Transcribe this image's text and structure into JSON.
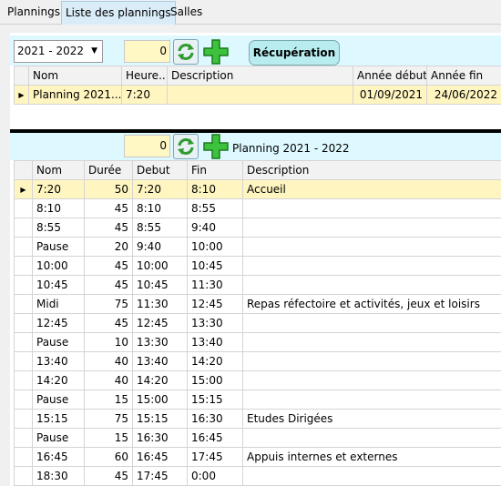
{
  "tabs": [
    {
      "label": "Plannings"
    },
    {
      "label": "Liste des plannings"
    },
    {
      "label": "Salles"
    }
  ],
  "top": {
    "year_select": "2021 - 2022",
    "counter": "0",
    "recup_label": "Récupération",
    "columns": [
      "Nom",
      "Heure...",
      "Description",
      "Année début",
      "Année fin"
    ],
    "row": {
      "nom": "Planning 2021...",
      "heure": "7:20",
      "description": "",
      "debut": "01/09/2021",
      "fin": "24/06/2022"
    }
  },
  "bottom": {
    "counter": "0",
    "planning_label": "Planning 2021 - 2022",
    "columns": [
      "Nom",
      "Durée",
      "Debut",
      "Fin",
      "Description"
    ],
    "rows": [
      {
        "nom": "7:20",
        "duree": "50",
        "debut": "7:20",
        "fin": "8:10",
        "desc": "Accueil"
      },
      {
        "nom": "8:10",
        "duree": "45",
        "debut": "8:10",
        "fin": "8:55",
        "desc": ""
      },
      {
        "nom": "8:55",
        "duree": "45",
        "debut": "8:55",
        "fin": "9:40",
        "desc": ""
      },
      {
        "nom": "Pause",
        "duree": "20",
        "debut": "9:40",
        "fin": "10:00",
        "desc": ""
      },
      {
        "nom": "10:00",
        "duree": "45",
        "debut": "10:00",
        "fin": "10:45",
        "desc": ""
      },
      {
        "nom": "10:45",
        "duree": "45",
        "debut": "10:45",
        "fin": "11:30",
        "desc": ""
      },
      {
        "nom": "Midi",
        "duree": "75",
        "debut": "11:30",
        "fin": "12:45",
        "desc": "Repas réfectoire et activités, jeux et loisirs"
      },
      {
        "nom": "12:45",
        "duree": "45",
        "debut": "12:45",
        "fin": "13:30",
        "desc": ""
      },
      {
        "nom": "Pause",
        "duree": "10",
        "debut": "13:30",
        "fin": "13:40",
        "desc": ""
      },
      {
        "nom": "13:40",
        "duree": "40",
        "debut": "13:40",
        "fin": "14:20",
        "desc": ""
      },
      {
        "nom": "14:20",
        "duree": "40",
        "debut": "14:20",
        "fin": "15:00",
        "desc": ""
      },
      {
        "nom": "Pause",
        "duree": "15",
        "debut": "15:00",
        "fin": "15:15",
        "desc": ""
      },
      {
        "nom": "15:15",
        "duree": "75",
        "debut": "15:15",
        "fin": "16:30",
        "desc": "Etudes Dirigées"
      },
      {
        "nom": "Pause",
        "duree": "15",
        "debut": "16:30",
        "fin": "16:45",
        "desc": ""
      },
      {
        "nom": "16:45",
        "duree": "60",
        "debut": "16:45",
        "fin": "17:45",
        "desc": "Appuis internes et externes"
      },
      {
        "nom": "18:30",
        "duree": "45",
        "debut": "17:45",
        "fin": "0:00",
        "desc": ""
      }
    ]
  }
}
